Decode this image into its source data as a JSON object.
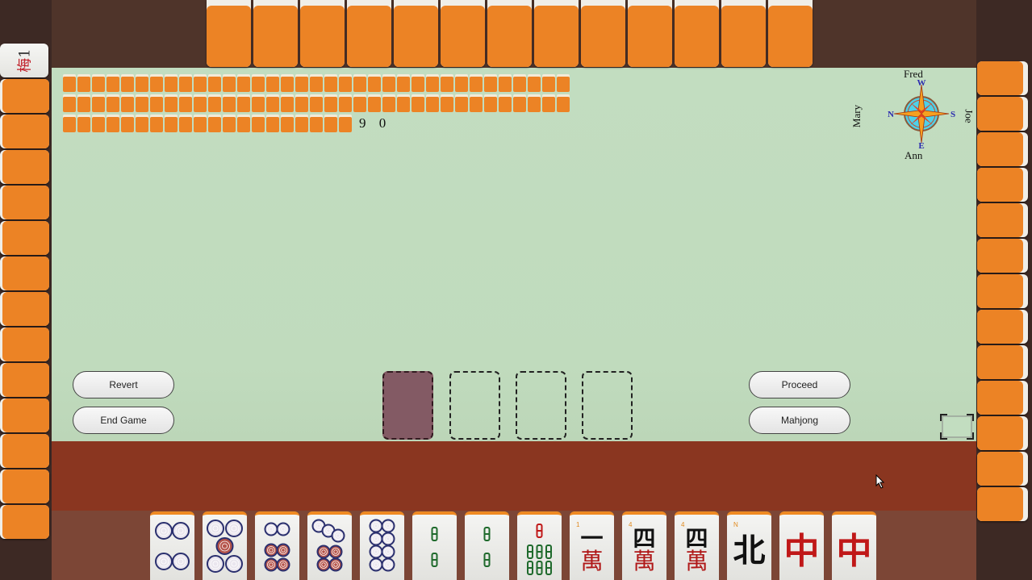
{
  "players": {
    "top": "Fred",
    "left": "Mary",
    "right": "Joe",
    "bottom": "Ann"
  },
  "compass": {
    "top": "W",
    "left": "N",
    "right": "S",
    "bottom": "E"
  },
  "wall": {
    "remaining": "9 0",
    "rows": [
      35,
      35,
      20
    ]
  },
  "opponents": {
    "top_tile_count": 13,
    "left_tile_count": 13,
    "right_tile_count": 13,
    "left_exposed": [
      {
        "type": "flower",
        "label": "Plum"
      }
    ]
  },
  "buttons": {
    "revert": "Revert",
    "end_game": "End Game",
    "proceed": "Proceed",
    "mahjong": "Mahjong"
  },
  "discard_slots": 4,
  "hand": [
    {
      "suit": "dots",
      "rank": 4
    },
    {
      "suit": "dots",
      "rank": 5
    },
    {
      "suit": "dots",
      "rank": 6
    },
    {
      "suit": "dots",
      "rank": 7
    },
    {
      "suit": "dots",
      "rank": 8
    },
    {
      "suit": "bamboo",
      "rank": 2
    },
    {
      "suit": "bamboo",
      "rank": 2
    },
    {
      "suit": "bamboo",
      "rank": 7
    },
    {
      "suit": "characters",
      "rank": 1,
      "corner": "1",
      "glyph": "一",
      "sub": "萬"
    },
    {
      "suit": "characters",
      "rank": 4,
      "corner": "4",
      "glyph": "四",
      "sub": "萬"
    },
    {
      "suit": "characters",
      "rank": 4,
      "corner": "4",
      "glyph": "四",
      "sub": "萬"
    },
    {
      "suit": "wind",
      "rank": "North",
      "corner": "N",
      "glyph": "北"
    },
    {
      "suit": "dragon",
      "rank": "Red",
      "glyph": "中"
    },
    {
      "suit": "dragon",
      "rank": "Red",
      "glyph": "中"
    }
  ],
  "colors": {
    "table": "#c2ddc0",
    "tile_back": "#ec8325",
    "rack": "#8a3620",
    "dots_blue": "#2a2f6e",
    "dots_red": "#b5544a",
    "bamboo_green": "#1f6a2c",
    "dragon_red": "#c01818"
  }
}
